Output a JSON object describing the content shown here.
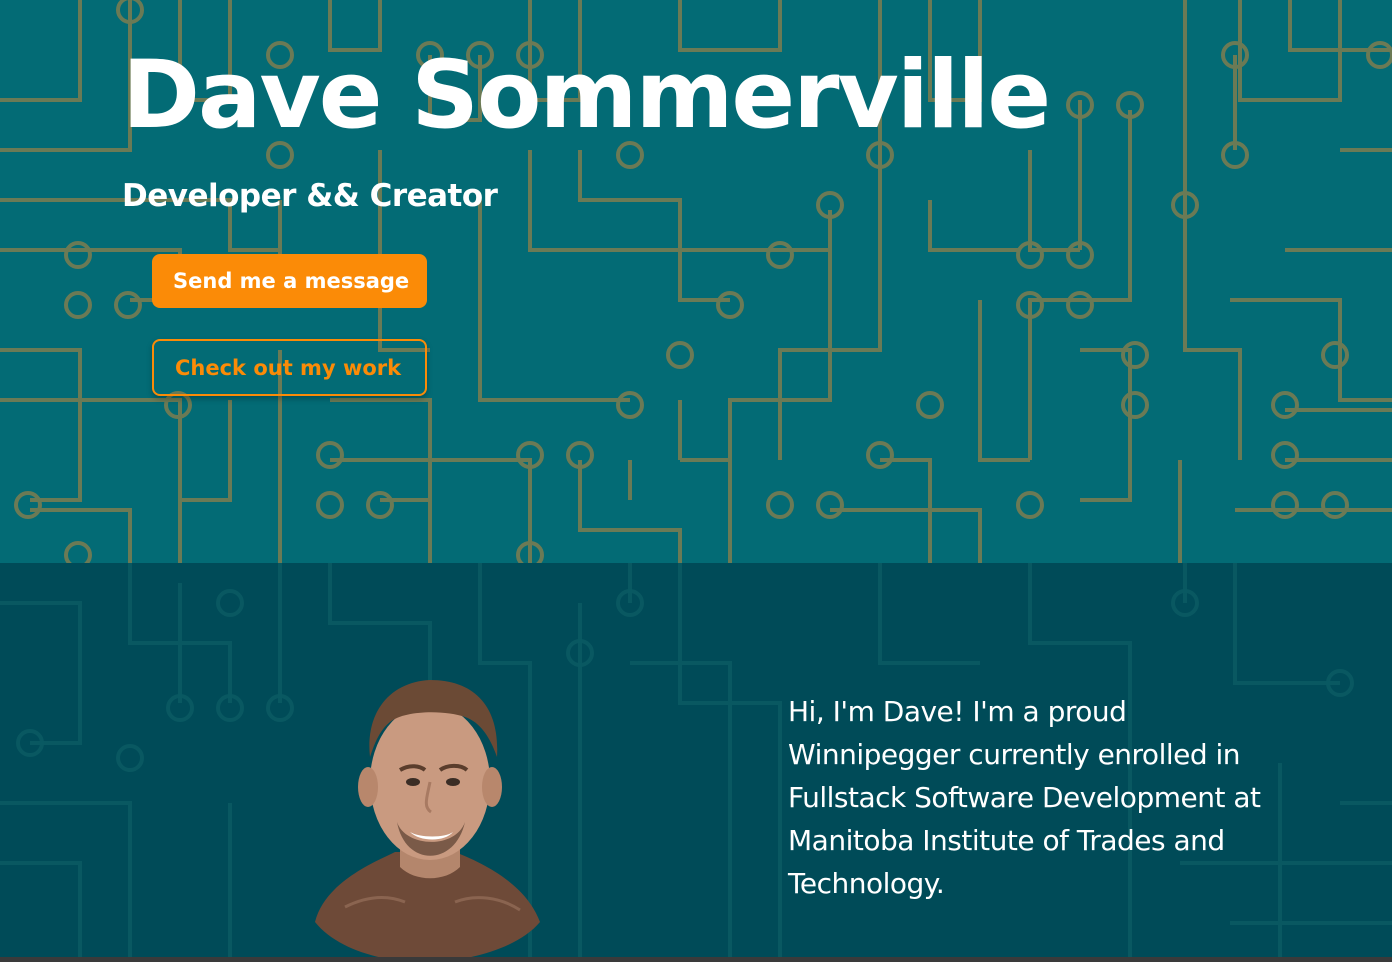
{
  "hero": {
    "title": "Dave Sommerville",
    "subtitle": "Developer && Creator",
    "primary_button_label": "Send me a message",
    "secondary_button_label": "Check out my work"
  },
  "about": {
    "intro": "Hi, I'm Dave! I'm a proud Winnipegger currently enrolled in Fullstack Software Development at Manitoba Institute of Trades and Technology."
  },
  "colors": {
    "hero_background": "#036b75",
    "about_background": "#004b58",
    "circuit_trace": "#6b7a55",
    "accent": "#fb8b07",
    "text": "#ffffff"
  }
}
